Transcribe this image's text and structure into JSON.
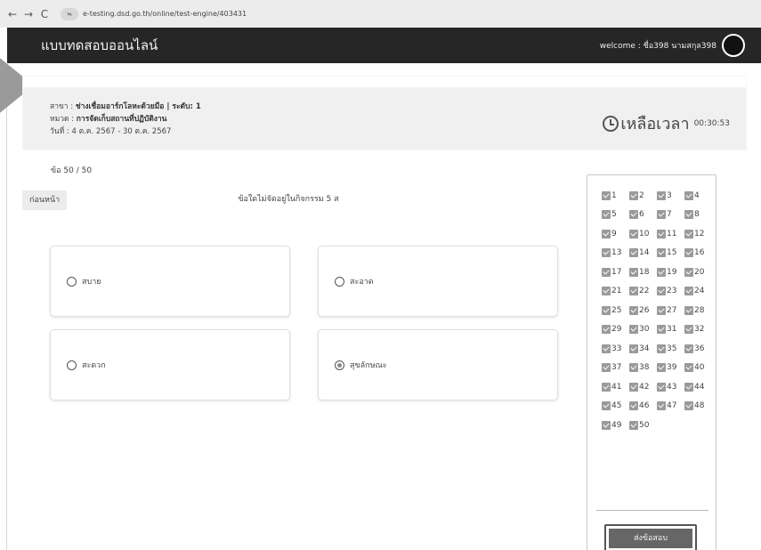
{
  "browser": {
    "back": "←",
    "forward": "→",
    "reload": "C",
    "site_icon": "≒",
    "url": "e-testing.dsd.go.th/online/test-engine/403431"
  },
  "header": {
    "title": "แบบทดสอบออนไลน์",
    "welcome": "welcome : ชื่อ398 นามสกุล398"
  },
  "info": {
    "branch_label": "สาขา : ",
    "branch_value": "ช่างเชื่อมอาร์กโลหะด้วยมือ | ระดับ: 1",
    "category_label": "หมวด : ",
    "category_value": "การจัดเก็บสถานที่ปฏิบัติงาน",
    "date": "วันที่ : 4 ต.ค. 2567 - 30 ต.ค. 2567"
  },
  "timer": {
    "label": "เหลือเวลา",
    "value": "00:30:53"
  },
  "question": {
    "counter": "ข้อ 50 / 50",
    "prev_label": "ก่อนหน้า",
    "text": "ข้อใดไม่จัดอยู่ในกิจกรรม 5 ส",
    "options": [
      {
        "label": "สบาย",
        "selected": false
      },
      {
        "label": "สะอาด",
        "selected": false
      },
      {
        "label": "สะดวก",
        "selected": false
      },
      {
        "label": "สุขลักษณะ",
        "selected": true
      }
    ]
  },
  "navigator": {
    "items": [
      "1",
      "2",
      "3",
      "4",
      "5",
      "6",
      "7",
      "8",
      "9",
      "10",
      "11",
      "12",
      "13",
      "14",
      "15",
      "16",
      "17",
      "18",
      "19",
      "20",
      "21",
      "22",
      "23",
      "24",
      "25",
      "26",
      "27",
      "28",
      "29",
      "30",
      "31",
      "32",
      "33",
      "34",
      "35",
      "36",
      "37",
      "38",
      "39",
      "40",
      "41",
      "42",
      "43",
      "44",
      "45",
      "46",
      "47",
      "48",
      "49",
      "50"
    ],
    "submit_label": "ส่งข้อสอบ"
  }
}
